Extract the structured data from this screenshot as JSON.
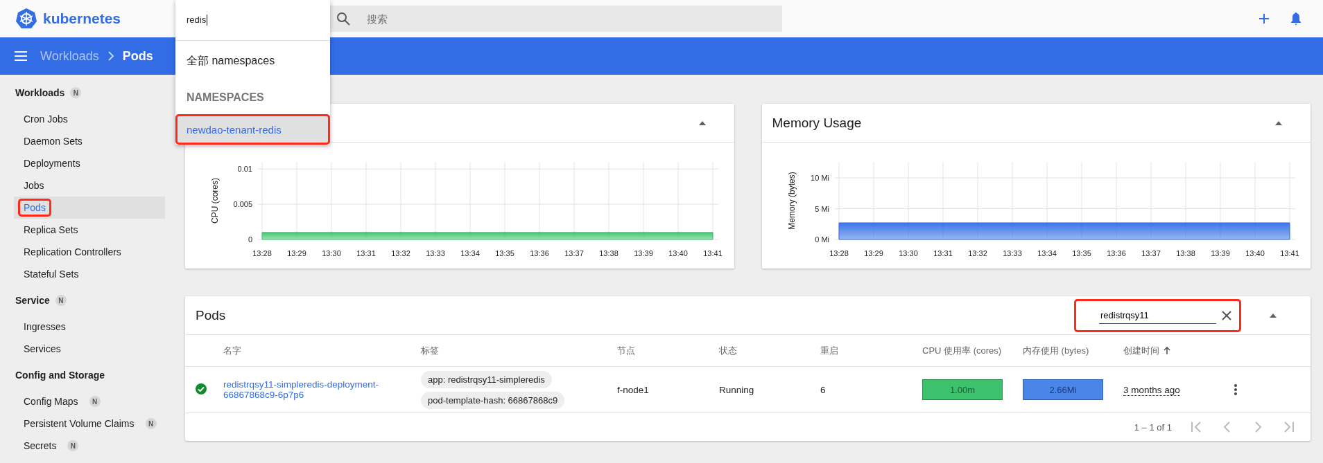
{
  "header": {
    "logo_text": "kubernetes",
    "search": {
      "placeholder": "搜索"
    }
  },
  "namespace_dropdown": {
    "query": "redis",
    "items": [
      {
        "kind": "option",
        "label": "全部 namespaces",
        "selected": false,
        "highlighted": false
      },
      {
        "kind": "heading",
        "label": "NAMESPACES"
      },
      {
        "kind": "option",
        "label": "newdao-tenant-redis",
        "selected": true,
        "highlighted": true
      }
    ]
  },
  "toolbar": {
    "breadcrumbs": [
      {
        "label": "Workloads",
        "current": false
      },
      {
        "label": "Pods",
        "current": true
      }
    ]
  },
  "sidebar": {
    "sections": [
      {
        "title": "Workloads",
        "badge": "N",
        "items": [
          {
            "label": "Cron Jobs",
            "selected": false,
            "highlighted": false
          },
          {
            "label": "Daemon Sets",
            "selected": false,
            "highlighted": false
          },
          {
            "label": "Deployments",
            "selected": false,
            "highlighted": false
          },
          {
            "label": "Jobs",
            "selected": false,
            "highlighted": false
          },
          {
            "label": "Pods",
            "selected": true,
            "highlighted": true
          },
          {
            "label": "Replica Sets",
            "selected": false,
            "highlighted": false
          },
          {
            "label": "Replication Controllers",
            "selected": false,
            "highlighted": false
          },
          {
            "label": "Stateful Sets",
            "selected": false,
            "highlighted": false
          }
        ]
      },
      {
        "title": "Service",
        "badge": "N",
        "items": [
          {
            "label": "Ingresses",
            "selected": false,
            "highlighted": false
          },
          {
            "label": "Services",
            "selected": false,
            "highlighted": false
          }
        ]
      },
      {
        "title": "Config and Storage",
        "items": [
          {
            "label": "Config Maps",
            "badge": "N",
            "selected": false,
            "highlighted": false
          },
          {
            "label": "Persistent Volume Claims",
            "badge": "N",
            "selected": false,
            "highlighted": false
          },
          {
            "label": "Secrets",
            "badge": "N",
            "selected": false,
            "highlighted": false
          }
        ]
      }
    ]
  },
  "cpu_card": {
    "chart_data": {
      "type": "area",
      "ylabel": "CPU (cores)",
      "categories": [
        "13:28",
        "13:29",
        "13:30",
        "13:31",
        "13:32",
        "13:33",
        "13:34",
        "13:35",
        "13:36",
        "13:37",
        "13:38",
        "13:39",
        "13:40",
        "13:41"
      ],
      "ylim": [
        0,
        0.011
      ],
      "yticks": [
        0,
        0.005,
        0.01
      ],
      "series": [
        {
          "color": "#3cc26c",
          "values": [
            0.001,
            0.001,
            0.001,
            0.001,
            0.001,
            0.001,
            0.001,
            0.001,
            0.001,
            0.001,
            0.001,
            0.001,
            0.001,
            0.001
          ]
        }
      ],
      "grid": true
    }
  },
  "memory_card": {
    "title": "Memory Usage",
    "chart_data": {
      "type": "area",
      "ylabel": "Memory (bytes)",
      "categories": [
        "13:28",
        "13:29",
        "13:30",
        "13:31",
        "13:32",
        "13:33",
        "13:34",
        "13:35",
        "13:36",
        "13:37",
        "13:38",
        "13:39",
        "13:40",
        "13:41"
      ],
      "ylim": [
        0,
        12.6
      ],
      "yticks": [
        {
          "value": 0,
          "label": "0 Mi"
        },
        {
          "value": 5,
          "label": "5 Mi"
        },
        {
          "value": 10,
          "label": "10 Mi"
        }
      ],
      "series": [
        {
          "color": "#326de6",
          "values": [
            2.7,
            2.7,
            2.7,
            2.7,
            2.7,
            2.7,
            2.7,
            2.7,
            2.7,
            2.7,
            2.7,
            2.7,
            2.7,
            2.7
          ]
        }
      ],
      "grid": true
    }
  },
  "pods": {
    "title": "Pods",
    "filter": {
      "value": "redistrqsy11",
      "highlighted": true
    },
    "columns": [
      {
        "label": "名字",
        "sorted": false
      },
      {
        "label": "标签",
        "sorted": false
      },
      {
        "label": "节点",
        "sorted": false
      },
      {
        "label": "状态",
        "sorted": false
      },
      {
        "label": "重启",
        "sorted": false
      },
      {
        "label": "CPU 使用率 (cores)",
        "sorted": false
      },
      {
        "label": "内存使用 (bytes)",
        "sorted": false
      },
      {
        "label": "创建时间",
        "sorted": true
      }
    ],
    "rows": [
      {
        "healthy": true,
        "name": "redistrqsy11-simpleredis-deployment-66867868c9-6p7p6",
        "labels": [
          "app: redistrqsy11-simpleredis",
          "pod-template-hash: 66867868c9"
        ],
        "node": "f-node1",
        "state": "Running",
        "restarts": "6",
        "cpu": "1.00m",
        "memory": "2.66Mi",
        "created": "3 months ago"
      }
    ],
    "pagination": {
      "range": "1 – 1 of 1"
    }
  }
}
